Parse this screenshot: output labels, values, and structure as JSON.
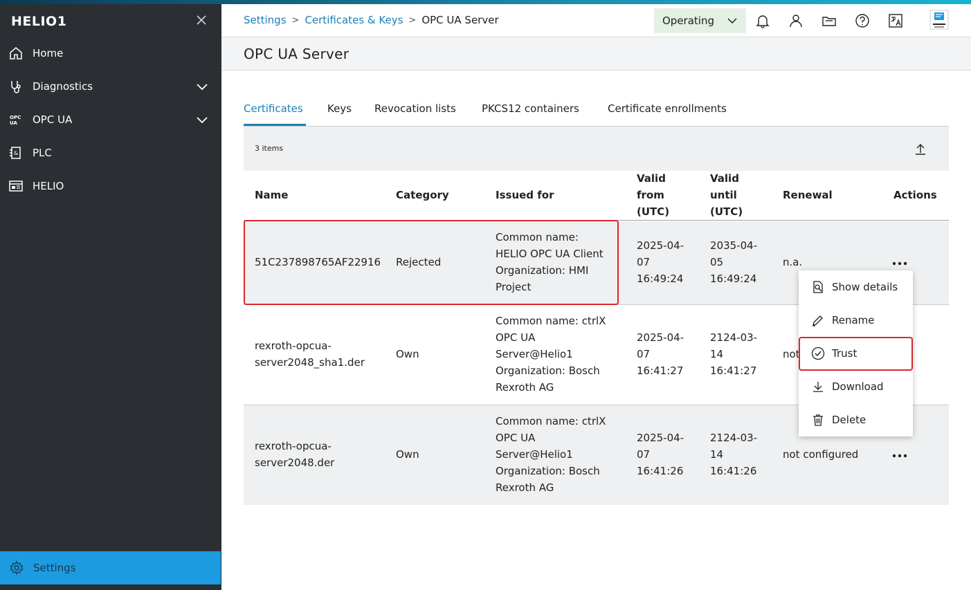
{
  "sidebar": {
    "title": "HELIO1",
    "items": [
      {
        "label": "Home",
        "icon": "home-icon"
      },
      {
        "label": "Diagnostics",
        "icon": "stethoscope-icon",
        "expandable": true
      },
      {
        "label": "OPC UA",
        "icon": "opcua-icon",
        "expandable": true
      },
      {
        "label": "PLC",
        "icon": "plc-icon"
      },
      {
        "label": "HELIO",
        "icon": "helio-icon"
      }
    ],
    "settings_label": "Settings"
  },
  "header": {
    "breadcrumb": [
      "Settings",
      "Certificates & Keys",
      "OPC UA Server"
    ],
    "state": "Operating"
  },
  "page": {
    "title": "OPC UA Server"
  },
  "tabs": [
    {
      "label": "Certificates",
      "active": true
    },
    {
      "label": "Keys"
    },
    {
      "label": "Revocation lists"
    },
    {
      "label": "PKCS12 containers"
    },
    {
      "label": "Certificate enrollments"
    }
  ],
  "table": {
    "count": "3 items",
    "headers": {
      "name": "Name",
      "category": "Category",
      "issued_for": "Issued for",
      "valid_from": [
        "Valid",
        "from",
        "(UTC)"
      ],
      "valid_until": [
        "Valid",
        "until",
        "(UTC)"
      ],
      "renewal": "Renewal",
      "actions": "Actions"
    },
    "rows": [
      {
        "name": [
          "51C237898765AF22916"
        ],
        "category": "Rejected",
        "issued_for": [
          "Common name:",
          "HELIO OPC UA Client",
          "Organization: HMI",
          "Project"
        ],
        "valid_from": [
          "2025-04-",
          "07",
          "16:49:24"
        ],
        "valid_until": [
          "2035-04-",
          "05",
          "16:49:24"
        ],
        "renewal": "n.a."
      },
      {
        "name": [
          "rexroth-opcua-",
          "server2048_sha1.der"
        ],
        "category": "Own",
        "issued_for": [
          "Common name: ctrlX",
          "OPC UA",
          "Server@Helio1",
          "Organization: Bosch",
          "Rexroth AG"
        ],
        "valid_from": [
          "2025-04-",
          "07",
          "16:41:27"
        ],
        "valid_until": [
          "2124-03-",
          "14",
          "16:41:27"
        ],
        "renewal": "not"
      },
      {
        "name": [
          "rexroth-opcua-",
          "server2048.der"
        ],
        "category": "Own",
        "issued_for": [
          "Common name: ctrlX",
          "OPC UA",
          "Server@Helio1",
          "Organization: Bosch",
          "Rexroth AG"
        ],
        "valid_from": [
          "2025-04-",
          "07",
          "16:41:26"
        ],
        "valid_until": [
          "2124-03-",
          "14",
          "16:41:26"
        ],
        "renewal": "not configured"
      }
    ]
  },
  "menu": {
    "items": [
      {
        "label": "Show details",
        "icon": "show-details-icon"
      },
      {
        "label": "Rename",
        "icon": "pencil-icon"
      },
      {
        "label": "Trust",
        "icon": "check-circle-icon"
      },
      {
        "label": "Download",
        "icon": "download-icon"
      },
      {
        "label": "Delete",
        "icon": "trash-icon"
      }
    ]
  },
  "colors": {
    "sidebar_bg": "#2b2f33",
    "accent": "#1d9be0",
    "link": "#1d7fb3",
    "highlight": "#d8272c",
    "state_bg": "#e4f0e4"
  }
}
